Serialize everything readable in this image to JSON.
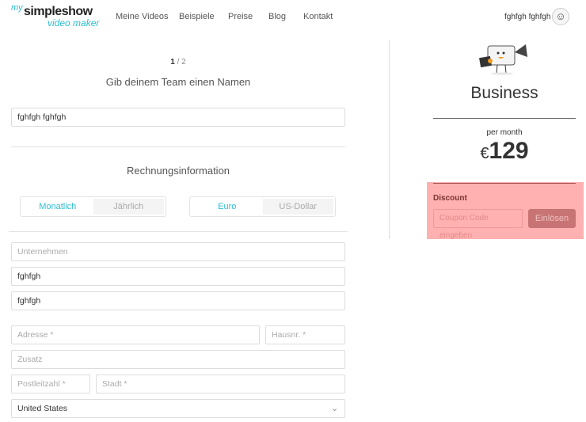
{
  "header": {
    "logo": {
      "my": "my",
      "main": "simpleshow",
      "sub": "video maker"
    },
    "nav": [
      "Meine Videos",
      "Beispiele",
      "Preise",
      "Blog",
      "Kontakt"
    ],
    "user_name": "fghfgh fghfgh"
  },
  "steps": {
    "current": "1",
    "total": "/ 2"
  },
  "team": {
    "title": "Gib deinem Team einen Namen",
    "value": "fghfgh fghfgh"
  },
  "billing": {
    "title": "Rechnungsinformation",
    "period": {
      "options": [
        "Monatlich",
        "Jährlich"
      ],
      "selected": "Monatlich"
    },
    "currency": {
      "options": [
        "Euro",
        "US-Dollar"
      ],
      "selected": "Euro"
    },
    "company_placeholder": "Unternehmen",
    "first_name": "fghfgh",
    "last_name": "fghfgh",
    "address_placeholder": "Adresse *",
    "house_placeholder": "Hausnr. *",
    "extra_placeholder": "Zusatz",
    "zip_placeholder": "Postleitzahl *",
    "city_placeholder": "Stadt *",
    "country": "United States"
  },
  "plan": {
    "name": "Business",
    "period": "per month",
    "currency": "€",
    "price": "129"
  },
  "discount": {
    "label": "Discount",
    "placeholder": "Coupon Code eingeben",
    "button": "Einlösen",
    "highlight_color": "#ffb0b0"
  },
  "colors": {
    "accent": "#2bbdd0"
  }
}
